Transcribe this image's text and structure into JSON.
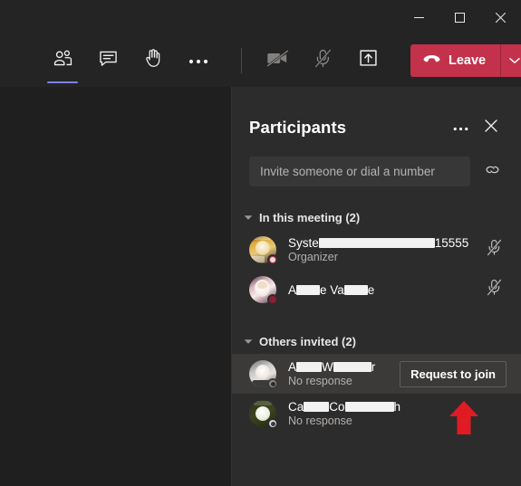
{
  "window": {
    "controls": [
      {
        "name": "minimize",
        "label": "Minimize",
        "glyph": "minimize-icon"
      },
      {
        "name": "maximize",
        "label": "Maximize",
        "glyph": "maximize-icon"
      },
      {
        "name": "close",
        "label": "Close",
        "glyph": "close-icon"
      }
    ]
  },
  "toolbar": {
    "left_items": [
      {
        "name": "people",
        "label": "Show participants",
        "icon": "people-icon",
        "active": true,
        "dim": false
      },
      {
        "name": "chat",
        "label": "Show conversation",
        "icon": "chat-icon",
        "active": false,
        "dim": false
      },
      {
        "name": "raise-hand",
        "label": "Raise your hand",
        "icon": "hand-icon",
        "active": false,
        "dim": false
      },
      {
        "name": "more",
        "label": "More actions",
        "icon": "ellipsis-icon",
        "active": false,
        "dim": false
      }
    ],
    "right_items": [
      {
        "name": "camera",
        "label": "Turn camera on",
        "icon": "camera-off-icon",
        "dim": true
      },
      {
        "name": "microphone",
        "label": "Unmute",
        "icon": "mic-off-icon",
        "dim": true
      },
      {
        "name": "share",
        "label": "Share content",
        "icon": "share-screen-icon",
        "dim": false
      }
    ],
    "leave": {
      "label": "Leave",
      "icon": "hangup-icon",
      "caret_icon": "chevron-down-icon",
      "color": "#c4314b"
    }
  },
  "panel": {
    "title": "Participants",
    "more_label": "More options",
    "more_icon": "ellipsis-icon",
    "close_label": "Close",
    "close_icon": "close-icon",
    "invite": {
      "placeholder": "Invite someone or dial a number",
      "value": "",
      "link_icon": "share-link-icon",
      "link_label": "Copy join link"
    },
    "sections": [
      {
        "name": "in-this-meeting",
        "label": "In this meeting (2)",
        "expanded": true,
        "chevron_icon": "chevron-down-icon",
        "rows": [
          {
            "name": "participant-system",
            "name_prefix": "Syste",
            "redacted": true,
            "redact_width": 128,
            "name_suffix": "15555",
            "subtitle": "Organizer",
            "avatar_colors": [
              "#e0a93b",
              "#f5deb0",
              "#2f2a1d"
            ],
            "badge_color": "#c4314b",
            "badge_type": "busy",
            "action": "mic-off",
            "action_icon": "mic-off-icon",
            "hovered": false
          },
          {
            "name": "participant-second",
            "name_prefix": "A",
            "name_mid": "e Va",
            "name_suffix": "e",
            "redacted": true,
            "redact_width": 26,
            "redact_width2": 26,
            "subtitle": "",
            "avatar_colors": [
              "#d7b7bd",
              "#f6eaea",
              "#4a2a3a"
            ],
            "badge_color": "#8b1f33",
            "badge_type": "busy",
            "action": "mic-off",
            "action_icon": "mic-off-icon",
            "hovered": false
          }
        ]
      },
      {
        "name": "others-invited",
        "label": "Others invited (2)",
        "expanded": true,
        "chevron_icon": "chevron-down-icon",
        "rows": [
          {
            "name": "invitee-first",
            "name_prefix": "A",
            "name_mid": " W",
            "name_suffix": "r",
            "redacted": true,
            "redact_width": 28,
            "redact_width2": 42,
            "subtitle": "No response",
            "avatar_colors": [
              "#c9c9c9",
              "#efe6e0",
              "#6b6b6b"
            ],
            "badge_color": "#8a8886",
            "badge_type": "unknown",
            "action": "request-to-join",
            "action_label": "Request to join",
            "hovered": true
          },
          {
            "name": "invitee-second",
            "name_prefix": "Ca",
            "name_mid": " Co",
            "name_suffix": "h",
            "redacted": true,
            "redact_width": 28,
            "redact_width2": 54,
            "subtitle": "No response",
            "avatar_colors": [
              "#3c4420",
              "#2a3015",
              "#dfe4d2"
            ],
            "badge_color": "#d6d6d6",
            "badge_type": "unknown",
            "action": "none",
            "hovered": false
          }
        ]
      }
    ]
  },
  "annotation": {
    "name": "red-arrow",
    "color": "#e01b24",
    "points_at": "Request to join"
  }
}
